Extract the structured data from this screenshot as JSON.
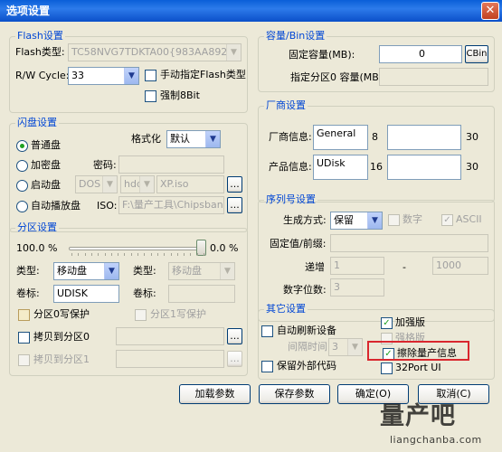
{
  "window": {
    "title": "选项设置",
    "close_icon": "close-icon"
  },
  "flash": {
    "legend": "Flash设置",
    "type_label": "Flash类型:",
    "type_value": "TC58NVG7TDKTA00{983AA8927650}",
    "rw_label": "R/W Cycle:",
    "rw_value": "33",
    "manual_label": "手动指定Flash类型",
    "force8_label": "强制8Bit"
  },
  "disk": {
    "legend": "闪盘设置",
    "format_label": "格式化",
    "format_value": "默认",
    "password_label": "密码:",
    "iso_label": "ISO:",
    "iso_path": "F:\\量产工具\\Chipsbank\\C",
    "modes": [
      {
        "label": "普通盘",
        "checked": true
      },
      {
        "label": "加密盘",
        "checked": false
      },
      {
        "label": "启动盘",
        "checked": false
      },
      {
        "label": "自动播放盘",
        "checked": false
      }
    ],
    "boot_os": "DOS",
    "boot_media": "hdd",
    "boot_image": "XP.iso",
    "browse": "..."
  },
  "partition": {
    "legend": "分区设置",
    "left_percent": "100.0 %",
    "right_percent": "0.0 %",
    "split_fraction": 1.0,
    "type_label_1": "类型:",
    "type_value_1": "移动盘",
    "type_label_2": "类型:",
    "type_value_2": "移动盘",
    "volume_label_1": "卷标:",
    "volume_value_1": "UDISK",
    "volume_label_2": "卷标:",
    "wp0_label": "分区0写保护",
    "wp1_label": "分区1写保护",
    "copy0_label": "拷贝到分区0",
    "copy1_label": "拷贝到分区1",
    "browse": "..."
  },
  "capacity": {
    "legend": "容量/Bin设置",
    "fixed_label": "固定容量(MB):",
    "fixed_value": "0",
    "cbin_label": "CBin",
    "fixed_part0_label": "指定分区0 容量(MB):"
  },
  "vendor": {
    "legend": "厂商设置",
    "vendor_label": "厂商信息:",
    "vendor_value": "General",
    "vendor_len": "8",
    "vendor_max": "30",
    "product_label": "产品信息:",
    "product_value": "UDisk",
    "product_len": "16",
    "product_max": "30"
  },
  "serial": {
    "legend": "序列号设置",
    "gen_label": "生成方式:",
    "gen_value": "保留",
    "digit_label": "数字",
    "ascii_label": "ASCII",
    "prefix_label": "固定值/前缀:",
    "step_label": "递增",
    "step_from": "1",
    "dash": "-",
    "step_to": "1000",
    "digits_label": "数字位数:",
    "digits_value": "3"
  },
  "other": {
    "legend": "其它设置",
    "auto_refresh_label": "自动刷新设备",
    "interval_label": "间隔时间",
    "interval_value": "3",
    "keep_code_label": "保留外部代码",
    "enhanced_label": "加强版",
    "strong_label": "强格版",
    "erase_label": "擦除量产信息",
    "port32_label": "32Port UI"
  },
  "buttons": {
    "load": "加载参数",
    "save": "保存参数",
    "ok": "确定(O)",
    "cancel": "取消(C)"
  },
  "watermark": {
    "cn": "量产吧",
    "url": "liangchanba.com"
  },
  "colors": {
    "title_bar": "#0b56d4",
    "legend_text": "#0046d5",
    "check_mark": "#21a121",
    "highlight": "#d9272e"
  }
}
